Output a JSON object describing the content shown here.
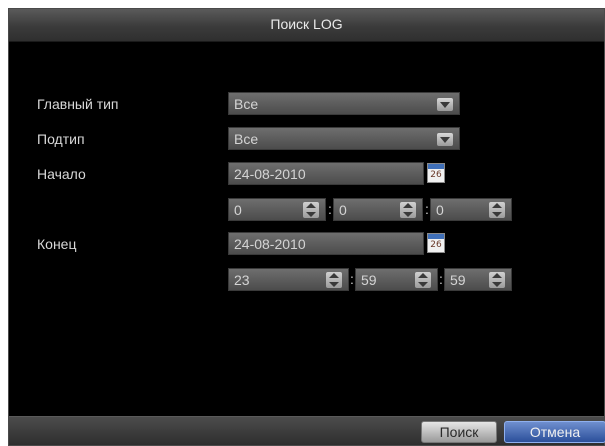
{
  "dialog": {
    "title": "Поиск LOG"
  },
  "form": {
    "main_type": {
      "label": "Главный тип",
      "value": "Все"
    },
    "subtype": {
      "label": "Подтип",
      "value": "Все"
    },
    "start": {
      "label": "Начало",
      "date": "24-08-2010",
      "calendar_day": "26",
      "hour": "0",
      "minute": "0",
      "second": "0"
    },
    "end": {
      "label": "Конец",
      "date": "24-08-2010",
      "calendar_day": "26",
      "hour": "23",
      "minute": "59",
      "second": "59"
    },
    "time_separator": ":"
  },
  "buttons": {
    "search": "Поиск",
    "cancel": "Отмена"
  },
  "colors": {
    "background": "#000000",
    "field": "#5a5a5a",
    "accent": "#2b4f9a"
  }
}
